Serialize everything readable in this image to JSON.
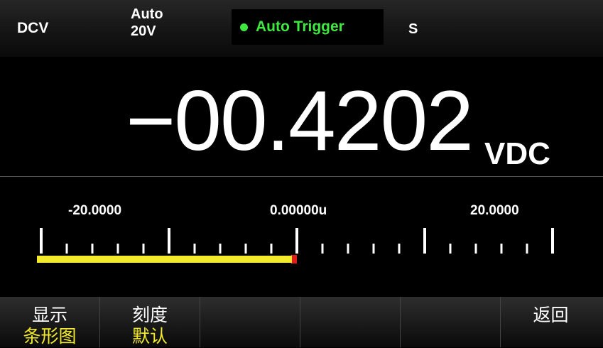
{
  "header": {
    "function": "DCV",
    "range_mode": "Auto",
    "range_value": "20V",
    "trigger": "Auto Trigger",
    "speed": "S"
  },
  "measurement": {
    "value": "−00.4202",
    "unit": "VDC"
  },
  "bar_graph": {
    "scale_labels": [
      "-20.0000",
      "0.00000u",
      "20.0000"
    ],
    "range_min": -20,
    "range_max": 20,
    "reading": -0.4202
  },
  "softkeys": [
    {
      "label": "显示",
      "value": "条形图"
    },
    {
      "label": "刻度",
      "value": "默认"
    },
    {
      "label": "",
      "value": ""
    },
    {
      "label": "",
      "value": ""
    },
    {
      "label": "",
      "value": ""
    },
    {
      "label": "返回",
      "value": ""
    }
  ],
  "colors": {
    "trigger": "#3ee83e",
    "softkey_value": "#f2ea2a",
    "bar_fill": "#f2ea2a",
    "bar_marker": "#e21b1b"
  }
}
